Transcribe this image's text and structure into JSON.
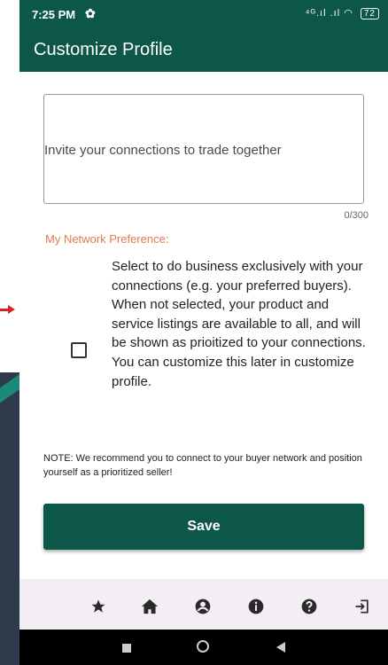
{
  "statusbar": {
    "time": "7:25 PM",
    "signal_text": "⁴ᴳ.ıl .ıl",
    "battery": "72"
  },
  "appbar": {
    "title": "Customize Profile"
  },
  "bio": {
    "placeholder": "Invite your connections to trade together",
    "counter": "0/300"
  },
  "network": {
    "label": "My Network Preference:",
    "description": "Select to do business exclusively with your connections (e.g. your preferred buyers). When not selected, your product and service listings are available to all, and will be shown as prioitized to your connections. You can customize this later in customize profile.",
    "checked": false
  },
  "note": "NOTE: We recommend you to connect to your buyer network and position yourself as a prioritized seller!",
  "save_label": "Save",
  "bottom_nav": {
    "icons": [
      "star-icon",
      "home-icon",
      "account-icon",
      "info-icon",
      "help-icon",
      "logout-icon"
    ]
  },
  "colors": {
    "primary": "#0d5748",
    "accent_label": "#e07a55"
  }
}
